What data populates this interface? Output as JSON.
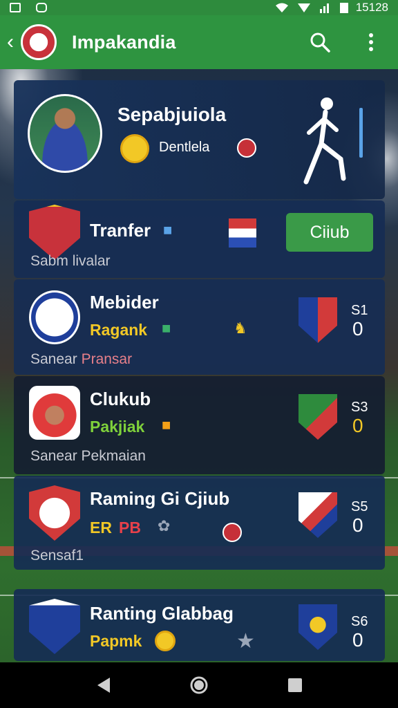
{
  "status_bar": {
    "time": "15128"
  },
  "app_bar": {
    "title": "Impakandia"
  },
  "profile": {
    "name": "Sepabjuiola",
    "subtitle": "Dentlela"
  },
  "rows": [
    {
      "title": "Tranfer",
      "footer": "Sabm livalar",
      "button_label": "Ciiub"
    },
    {
      "title": "Mebider",
      "sub": "Ragank",
      "footer_a": "Sanear",
      "footer_b": "Pransar",
      "stat_top": "S1",
      "stat_value": "0"
    },
    {
      "title": "Clukub",
      "sub": "Pakjiak",
      "footer": "Sanear Pekmaian",
      "stat_top": "S3",
      "stat_value": "0"
    },
    {
      "title": "Raming Gi Cjiub",
      "sub_a": "ER",
      "sub_b": "PB",
      "footer": "Sensaf1",
      "stat_top": "S5",
      "stat_value": "0"
    },
    {
      "title": "Ranting Glabbag",
      "sub": "Papmk",
      "stat_top": "S6",
      "stat_value": "0"
    }
  ],
  "colors": {
    "app_bar": "#2e9440",
    "accent_yellow": "#f2c826",
    "accent_green": "#7fd13b",
    "accent_red": "#e8404a",
    "button_green": "#3a9a48"
  },
  "icons": [
    "back-icon",
    "search-icon",
    "more-vert-icon",
    "coin-icon",
    "runner-icon",
    "home-icon",
    "recents-icon"
  ]
}
